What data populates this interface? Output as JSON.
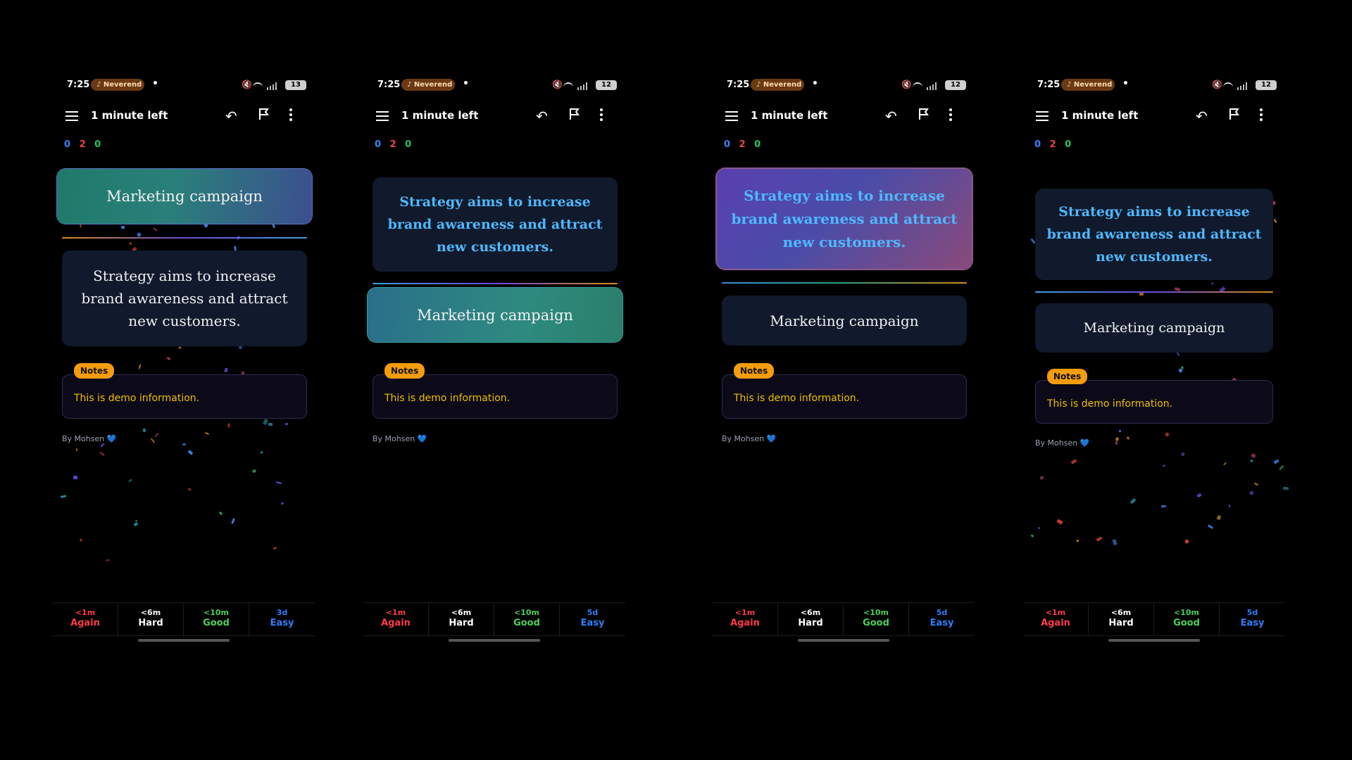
{
  "colors": {
    "background": "#000000",
    "card_plain": "#101a2c",
    "notes_badge": "#f59c0c",
    "notes_text": "#f0c000",
    "count_new": "#3b82f6",
    "count_learn": "#ef4444",
    "count_review": "#22c55e",
    "again": "#ff3b4a",
    "hard": "#ffffff",
    "good": "#4ccf5c",
    "easy": "#2f7fff"
  },
  "screens": [
    {
      "status": {
        "time": "7:25",
        "media_pill": "♪ Neverend",
        "dot": "•",
        "battery": "13"
      },
      "toolbar": {
        "title": "1 minute left"
      },
      "counts": {
        "new": "0",
        "learn": "2",
        "review": "0"
      },
      "front_card": "Marketing campaign",
      "back_card": "Strategy aims to increase brand awareness and attract new customers.",
      "notes": {
        "badge": "Notes",
        "text": "This is demo information."
      },
      "byline": "By Mohsen",
      "heart": "💙",
      "buttons": [
        {
          "interval": "<1m",
          "label": "Again"
        },
        {
          "interval": "<6m",
          "label": "Hard"
        },
        {
          "interval": "<10m",
          "label": "Good"
        },
        {
          "interval": "3d",
          "label": "Easy"
        }
      ]
    },
    {
      "status": {
        "time": "7:25",
        "media_pill": "♪ Neverend",
        "dot": "•",
        "battery": "12"
      },
      "toolbar": {
        "title": "1 minute left"
      },
      "counts": {
        "new": "0",
        "learn": "2",
        "review": "0"
      },
      "front_card": "Strategy aims to increase brand awareness and attract new customers.",
      "back_card": "Marketing campaign",
      "notes": {
        "badge": "Notes",
        "text": "This is demo information."
      },
      "byline": "By Mohsen",
      "heart": "💙",
      "buttons": [
        {
          "interval": "<1m",
          "label": "Again"
        },
        {
          "interval": "<6m",
          "label": "Hard"
        },
        {
          "interval": "<10m",
          "label": "Good"
        },
        {
          "interval": "5d",
          "label": "Easy"
        }
      ]
    },
    {
      "status": {
        "time": "7:25",
        "media_pill": "♪ Neverend",
        "dot": "•",
        "battery": "12"
      },
      "toolbar": {
        "title": "1 minute left"
      },
      "counts": {
        "new": "0",
        "learn": "2",
        "review": "0"
      },
      "front_card": "Strategy aims to increase brand awareness and attract new customers.",
      "back_card": "Marketing campaign",
      "notes": {
        "badge": "Notes",
        "text": "This is demo information."
      },
      "byline": "By Mohsen",
      "heart": "💙",
      "buttons": [
        {
          "interval": "<1m",
          "label": "Again"
        },
        {
          "interval": "<6m",
          "label": "Hard"
        },
        {
          "interval": "<10m",
          "label": "Good"
        },
        {
          "interval": "5d",
          "label": "Easy"
        }
      ]
    },
    {
      "status": {
        "time": "7:25",
        "media_pill": "♪ Neverend",
        "dot": "•",
        "battery": "12"
      },
      "toolbar": {
        "title": "1 minute left"
      },
      "counts": {
        "new": "0",
        "learn": "2",
        "review": "0"
      },
      "front_card": "Strategy aims to increase brand awareness and attract new customers.",
      "back_card": "Marketing campaign",
      "notes": {
        "badge": "Notes",
        "text": "This is demo information."
      },
      "byline": "By Mohsen",
      "heart": "💙",
      "buttons": [
        {
          "interval": "<1m",
          "label": "Again"
        },
        {
          "interval": "<6m",
          "label": "Hard"
        },
        {
          "interval": "<10m",
          "label": "Good"
        },
        {
          "interval": "5d",
          "label": "Easy"
        }
      ]
    }
  ]
}
